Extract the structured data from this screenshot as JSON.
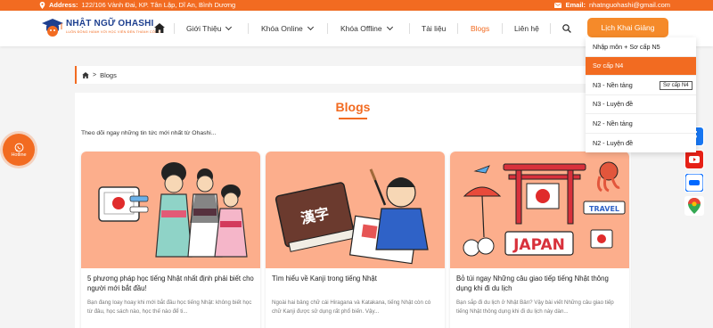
{
  "topbar": {
    "address_label": "Address:",
    "address": "122/106 Vành Đai, KP. Tân Lập, Dĩ An, Bình Dương",
    "email_label": "Email:",
    "email": "nhatnguohashi@gmail.com"
  },
  "logo": {
    "name": "NHẬT NGỮ OHASHI",
    "tagline": "LUÔN ĐỒNG HÀNH VỚI HỌC VIÊN ĐẾN THÀNH CÔNG"
  },
  "nav": {
    "items": [
      {
        "label": "Giới Thiệu"
      },
      {
        "label": "Khóa Online"
      },
      {
        "label": "Khóa Offline"
      },
      {
        "label": "Tài liệu"
      },
      {
        "label": "Blogs"
      },
      {
        "label": "Liên hệ"
      }
    ],
    "cta": "Lịch Khai Giảng"
  },
  "dropdown": {
    "items": [
      {
        "label": "Nhập môn + Sơ cấp N5"
      },
      {
        "label": "Sơ cấp N4"
      },
      {
        "label": "N3 - Nền tảng"
      },
      {
        "label": "N3 - Luyện đề"
      },
      {
        "label": "N2 - Nền tảng"
      },
      {
        "label": "N2 - Luyện đề"
      }
    ],
    "active_index": 1,
    "tooltip": "Sơ cấp N4"
  },
  "breadcrumb": {
    "current": "Blogs"
  },
  "main": {
    "title": "Blogs",
    "intro": "Theo dõi ngay những tin tức mới nhất từ Ohashi...",
    "cards": [
      {
        "title": "5 phương pháp học tiếng Nhật nhất định phải biết cho người mới bắt đầu!",
        "excerpt": "Bạn đang loay hoay khi mới bắt đầu học tiếng Nhật: không biết học từ đâu, học sách nào, học thế nào để ti..."
      },
      {
        "title": "Tìm hiểu về Kanji trong tiếng Nhật",
        "excerpt": "Ngoài hai bảng chữ cái Hiragana và Katakana, tiếng Nhật còn có chữ Kanji được sử dụng rất phổ biến. Vậy..."
      },
      {
        "title": "Bỏ túi ngay Những câu giao tiếp tiếng Nhật thông dụng khi đi du lịch",
        "excerpt": "Bạn sắp đi du lịch ở Nhật Bản? Vậy bài viết Những câu giao tiếp tiếng Nhật thông dụng khi đi du lịch này dàn..."
      }
    ],
    "card2_art_text": "漢字",
    "card3_art_text": "JAPAN",
    "card3_tag_text": "TRAVEL"
  },
  "hotline": {
    "label": "Hotline"
  },
  "colors": {
    "brand_orange": "#f26b21",
    "cta_orange": "#f58a2a",
    "card_bg": "#fcae8c",
    "logo_blue": "#1d3f8f"
  },
  "icons": [
    "location-icon",
    "mail-icon",
    "home-icon",
    "search-icon",
    "whatsapp-icon",
    "facebook-icon",
    "youtube-icon",
    "zalo-icon",
    "maps-icon"
  ]
}
